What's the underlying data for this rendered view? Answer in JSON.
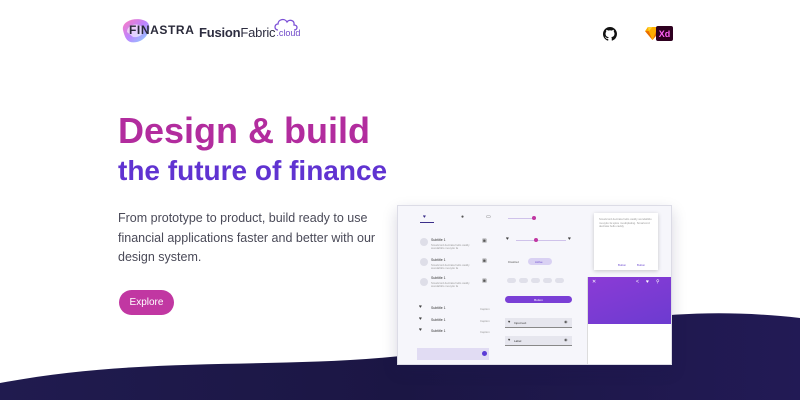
{
  "header": {
    "brand": "FINASTRA",
    "product_main": "Fusion",
    "product_second": "Fabric",
    "product_suffix": ".cloud",
    "xd_label": "Xd"
  },
  "icons": [
    "github-icon",
    "sketch-icon",
    "adobe-xd-icon",
    "heart-icon",
    "share-icon",
    "search-icon"
  ],
  "hero": {
    "title": "Design & build",
    "subtitle": "the future of finance",
    "description": "From prototype to product, build ready to use financial applications faster and better with our design system.",
    "cta_label": "Explore"
  },
  "mockup": {
    "list_items": [
      {
        "title": "Subtitle 1",
        "line1": "Smartcord decirata hello caddy",
        "line2": "wondahklo mouytio fa"
      },
      {
        "title": "Subtitle 1",
        "line1": "Smartcord decirata hello caddy",
        "line2": "wondahklo mouytio fa"
      },
      {
        "title": "Subtitle 1",
        "line1": "Smartcord decirata hello caddy",
        "line2": "wondahklo mouytio fa"
      }
    ],
    "simple_items": [
      {
        "title": "Subtitle 1",
        "caption": "Caption"
      },
      {
        "title": "Subtitle 1",
        "caption": "Caption"
      },
      {
        "title": "Subtitle 1",
        "caption": "Caption"
      }
    ],
    "toggle_left": "Disabled",
    "toggle_right": "Active",
    "button_label": "Button",
    "field1_label": "Input text",
    "field2_label": "Label",
    "card_text": "Smartcord decirata hello caddy wondahklo mouytio fa spice moubplating. Smartcord decirata hello caddy",
    "card_button1": "Button",
    "card_button2": "Button"
  },
  "colors": {
    "title_magenta": "#b22c9e",
    "subtitle_purple": "#6033d1",
    "button_magenta": "#c137a2",
    "wave_navy": "#1c1748",
    "xd_bg": "#2e001f",
    "xd_text": "#ff61f6"
  }
}
